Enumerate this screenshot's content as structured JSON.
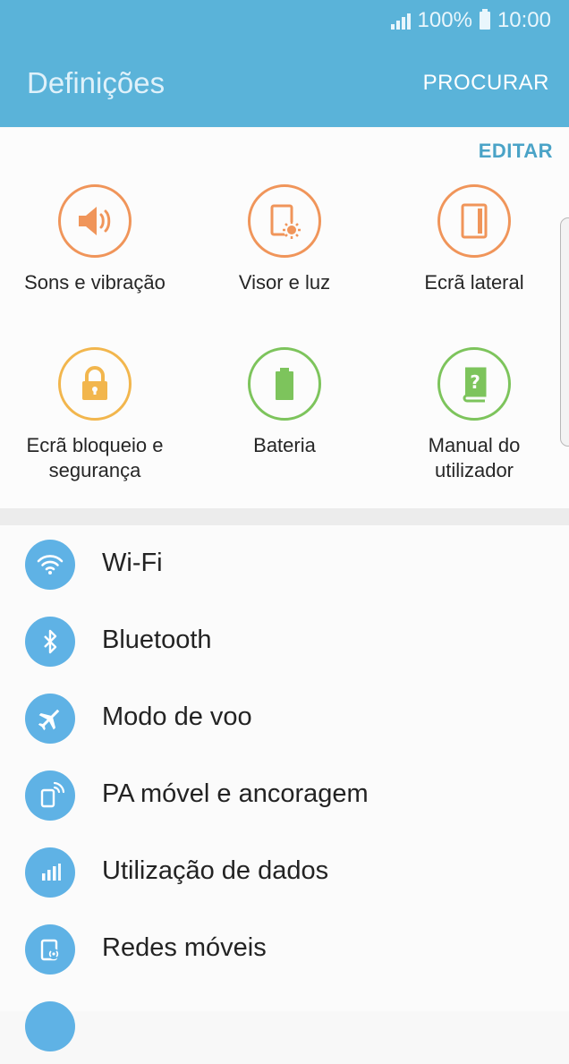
{
  "status_bar": {
    "battery": "100%",
    "time": "10:00"
  },
  "header": {
    "title": "Definições",
    "search_label": "PROCURAR"
  },
  "quick_settings": {
    "edit_label": "EDITAR",
    "items": [
      {
        "label": "Sons e vibração",
        "icon": "speaker-icon",
        "color": "#f0955a"
      },
      {
        "label": "Visor e luz",
        "icon": "display-brightness-icon",
        "color": "#f0955a"
      },
      {
        "label": "Ecrã lateral",
        "icon": "edge-screen-icon",
        "color": "#f0955a"
      },
      {
        "label": "Ecrã bloqueio e segurança",
        "icon": "lock-icon",
        "color": "#f2b64d"
      },
      {
        "label": "Bateria",
        "icon": "battery-icon",
        "color": "#7dc45c"
      },
      {
        "label": "Manual do utilizador",
        "icon": "help-book-icon",
        "color": "#7dc45c"
      }
    ]
  },
  "settings_list": [
    {
      "label": "Wi-Fi",
      "icon": "wifi-icon"
    },
    {
      "label": "Bluetooth",
      "icon": "bluetooth-icon"
    },
    {
      "label": "Modo de voo",
      "icon": "airplane-icon"
    },
    {
      "label": "PA móvel e ancoragem",
      "icon": "hotspot-icon"
    },
    {
      "label": "Utilização de dados",
      "icon": "data-usage-icon"
    },
    {
      "label": "Redes móveis",
      "icon": "mobile-networks-icon"
    }
  ],
  "colors": {
    "header_bg": "#5ab3d9",
    "accent": "#4aa3c7",
    "list_icon_bg": "#5fb2e5"
  }
}
